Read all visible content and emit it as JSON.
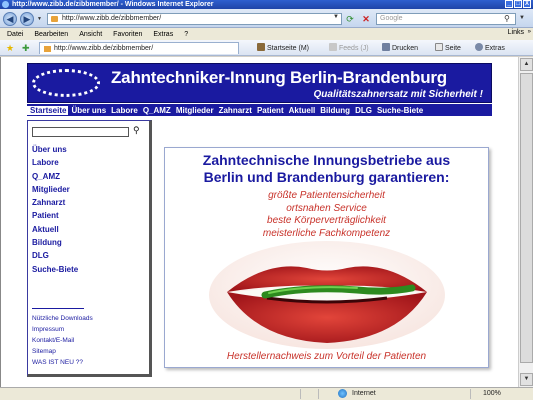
{
  "window": {
    "title": "http://www.zibb.de/zibbmember/ - Windows Internet Explorer",
    "controls": [
      "_",
      "□",
      "X"
    ]
  },
  "addressbar": {
    "url": "http://www.zibb.de/zibbmember/",
    "search_placeholder": "Google"
  },
  "menubar": {
    "items": [
      "Datei",
      "Bearbeiten",
      "Ansicht",
      "Favoriten",
      "Extras",
      "?"
    ],
    "links": "Links"
  },
  "commandbar": {
    "tab_label": "http://www.zibb.de/zibbmember/",
    "home": "Startseite (M)",
    "feeds": "Feeds (J)",
    "print": "Drucken",
    "page": "Seite",
    "tools": "Extras"
  },
  "site": {
    "title": "Zahntechniker-Innung Berlin-Brandenburg",
    "slogan": "Qualitätszahnersatz mit Sicherheit !",
    "topnav": [
      "Startseite",
      "Über uns",
      "Labore",
      "Q_AMZ",
      "Mitglieder",
      "Zahnarzt",
      "Patient",
      "Aktuell",
      "Bildung",
      "DLG",
      "Suche-Biete"
    ],
    "sidebar_nav": [
      "Über uns",
      "Labore",
      "Q_AMZ",
      "Mitglieder",
      "Zahnarzt",
      "Patient",
      "Aktuell",
      "Bildung",
      "DLG",
      "Suche-Biete"
    ],
    "sidebar_footer": [
      "Nützliche Downloads",
      "Impressum",
      "Kontakt/E-Mail",
      "Sitemap",
      "WAS IST NEU ??"
    ],
    "main_heading_1": "Zahntechnische Innungsbetriebe aus",
    "main_heading_2": "Berlin und Brandenburg garantieren:",
    "main_lines": [
      "größte Patientensicherheit",
      "ortsnahen Service",
      "beste Körperverträglichkeit",
      "meisterliche Fachkompetenz"
    ],
    "main_footer": "Herstellernachweis zum Vorteil der Patienten"
  },
  "statusbar": {
    "zone": "Internet",
    "zoom": "100%"
  },
  "colors": {
    "brand_blue": "#1a1aa0",
    "accent_red": "#c8322a",
    "titlebar": "#2f5fcf"
  }
}
